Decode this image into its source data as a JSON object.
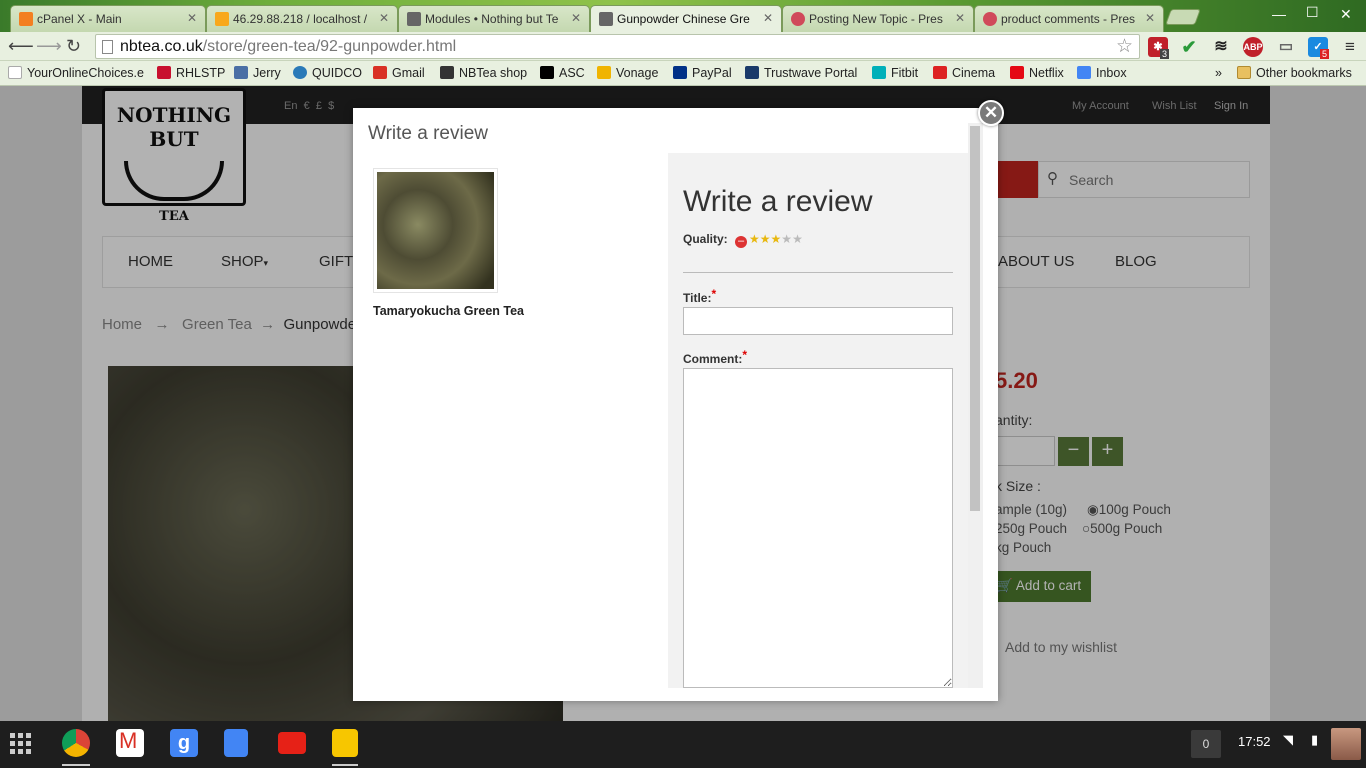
{
  "browser": {
    "tabs": [
      {
        "title": "cPanel X - Main",
        "favicon_color": "#f37f21"
      },
      {
        "title": "46.29.88.218 / localhost /",
        "favicon_color": "#f8a81c"
      },
      {
        "title": "Modules • Nothing but Te",
        "favicon_color": "#666666"
      },
      {
        "title": "Gunpowder Chinese Gre",
        "favicon_color": "#666666",
        "active": true
      },
      {
        "title": "Posting New Topic - Pres",
        "favicon_color": "#d04a5a"
      },
      {
        "title": "product comments - Pres",
        "favicon_color": "#d04a5a"
      }
    ],
    "url_host": "nbtea.co.uk",
    "url_path": "/store/green-tea/92-gunpowder.html",
    "extension_badges": [
      "3",
      "5"
    ],
    "bookmarks": [
      {
        "label": "YourOnlineChoices.e",
        "color": "#ffffff"
      },
      {
        "label": "RHLSTP",
        "color": "#c8102e"
      },
      {
        "label": "Jerry",
        "color": "#4a6fa5"
      },
      {
        "label": "QUIDCO",
        "color": "#2a7ab8"
      },
      {
        "label": "Gmail",
        "color": "#d93025"
      },
      {
        "label": "NBTea shop",
        "color": "#333333"
      },
      {
        "label": "ASC",
        "color": "#000000"
      },
      {
        "label": "Vonage",
        "color": "#f0b400"
      },
      {
        "label": "PayPal",
        "color": "#003087"
      },
      {
        "label": "Trustwave Portal",
        "color": "#1a3a6a"
      },
      {
        "label": "Fitbit",
        "color": "#00b0b9"
      },
      {
        "label": "Cinema",
        "color": "#d22"
      },
      {
        "label": "Netflix",
        "color": "#e50914"
      },
      {
        "label": "Inbox",
        "color": "#4285f4"
      }
    ],
    "bookmarks_more": "»",
    "other_bookmarks": "Other bookmarks"
  },
  "site": {
    "top_links_left": [
      "En",
      "€",
      "£",
      "$"
    ],
    "top_links_right": [
      "My Account",
      "Wish List",
      "Sign In"
    ],
    "logo_text": "NOTHING BUT",
    "logo_text2": "TEA",
    "menu": [
      "HOME",
      "SHOP",
      "GIFTS",
      "ABOUT US",
      "BLOG"
    ],
    "search_placeholder": "Search",
    "breadcrumb": {
      "home": "Home",
      "sep": "→",
      "category": "Green Tea",
      "current": "Gunpowde"
    },
    "price": "5.20",
    "quantity_label": "antity:",
    "pack_size_label": "k Size :",
    "pack_options": [
      "ample (10g)",
      "100g Pouch",
      "250g Pouch",
      "500g Pouch",
      "kg Pouch"
    ],
    "add_to_cart": "Add to cart",
    "wishlist": "Add to my wishlist",
    "qty_minus": "−",
    "qty_plus": "+"
  },
  "modal": {
    "header": "Write a review",
    "product_name": "Tamaryokucha Green Tea",
    "form_title": "Write a review",
    "quality_label": "Quality:",
    "rating": 3,
    "rating_max": 5,
    "title_label": "Title:",
    "comment_label": "Comment:",
    "required_mark": "*",
    "close_symbol": "✕"
  },
  "shelf": {
    "apps": [
      {
        "name": "Chrome",
        "color": "#db4437"
      },
      {
        "name": "Gmail",
        "color": "#ffffff"
      },
      {
        "name": "Google Search",
        "color": "#4285f4"
      },
      {
        "name": "Docs",
        "color": "#4285f4"
      },
      {
        "name": "YouTube",
        "color": "#e62117"
      },
      {
        "name": "Keep",
        "color": "#f7c600"
      }
    ],
    "notification_count": "0",
    "time": "17:52"
  }
}
